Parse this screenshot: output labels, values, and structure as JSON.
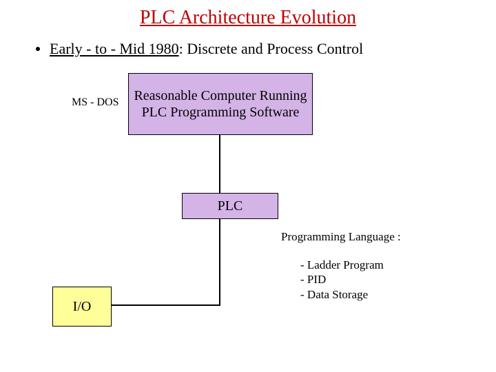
{
  "title": "PLC Architecture Evolution",
  "bullet": {
    "early": "Early - to - Mid 1980",
    "rest": "  :  Discrete and Process Control"
  },
  "labels": {
    "msdos": "MS - DOS"
  },
  "boxes": {
    "computer": "Reasonable Computer Running PLC Programming Software",
    "plc": "PLC",
    "io": "I/O"
  },
  "lang": {
    "heading": "Programming Language :",
    "items": [
      "- Ladder Program",
      "- PID",
      "- Data Storage"
    ]
  },
  "colors": {
    "title": "#c00000",
    "purple_box": "#d4b3e7",
    "yellow_box": "#ffff9a"
  }
}
